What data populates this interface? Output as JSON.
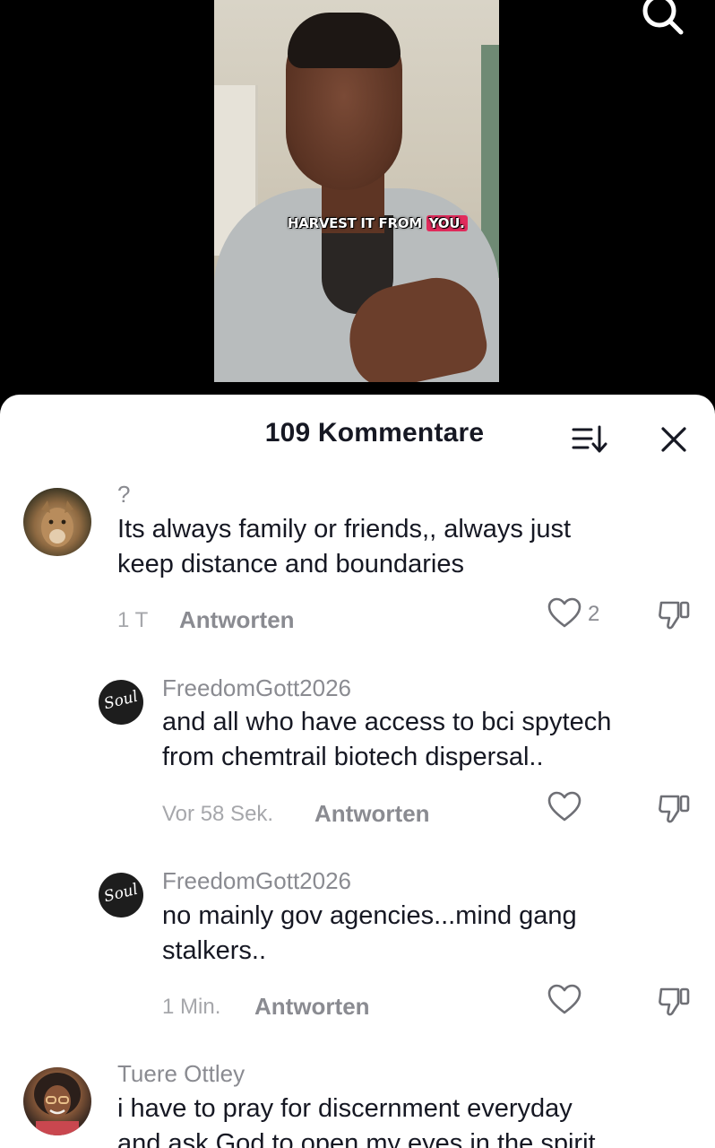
{
  "video": {
    "caption_main": "HARVEST IT FROM ",
    "caption_highlight": "YOU."
  },
  "sheet": {
    "title": "109 Kommentare"
  },
  "comments": [
    {
      "username": "?",
      "text_lines": [
        "Its always family or friends,, always just",
        "keep distance and boundaries"
      ],
      "time": "1 T",
      "reply": "Antworten",
      "likes": "2"
    },
    {
      "username": "FreedomGott2026",
      "text_lines": [
        "and all who have access to bci spytech",
        "from chemtrail biotech dispersal.."
      ],
      "time": "Vor 58 Sek.",
      "reply": "Antworten",
      "avatar_text": "Soul"
    },
    {
      "username": "FreedomGott2026",
      "text_lines": [
        "no mainly gov agencies...mind gang",
        "stalkers.."
      ],
      "time": "1 Min.",
      "reply": "Antworten",
      "avatar_text": "Soul"
    },
    {
      "username": "Tuere Ottley",
      "text_lines": [
        "i have to pray for discernment everyday",
        "and ask God to open my eyes in the spirit"
      ]
    }
  ],
  "icons": {
    "search": "search-icon",
    "sort": "sort-icon",
    "close": "close-icon",
    "like": "heart-icon",
    "dislike": "thumbs-down-icon"
  },
  "colors": {
    "caption_highlight": "#e22b5c",
    "text": "#161823",
    "muted": "#8a8b91"
  }
}
